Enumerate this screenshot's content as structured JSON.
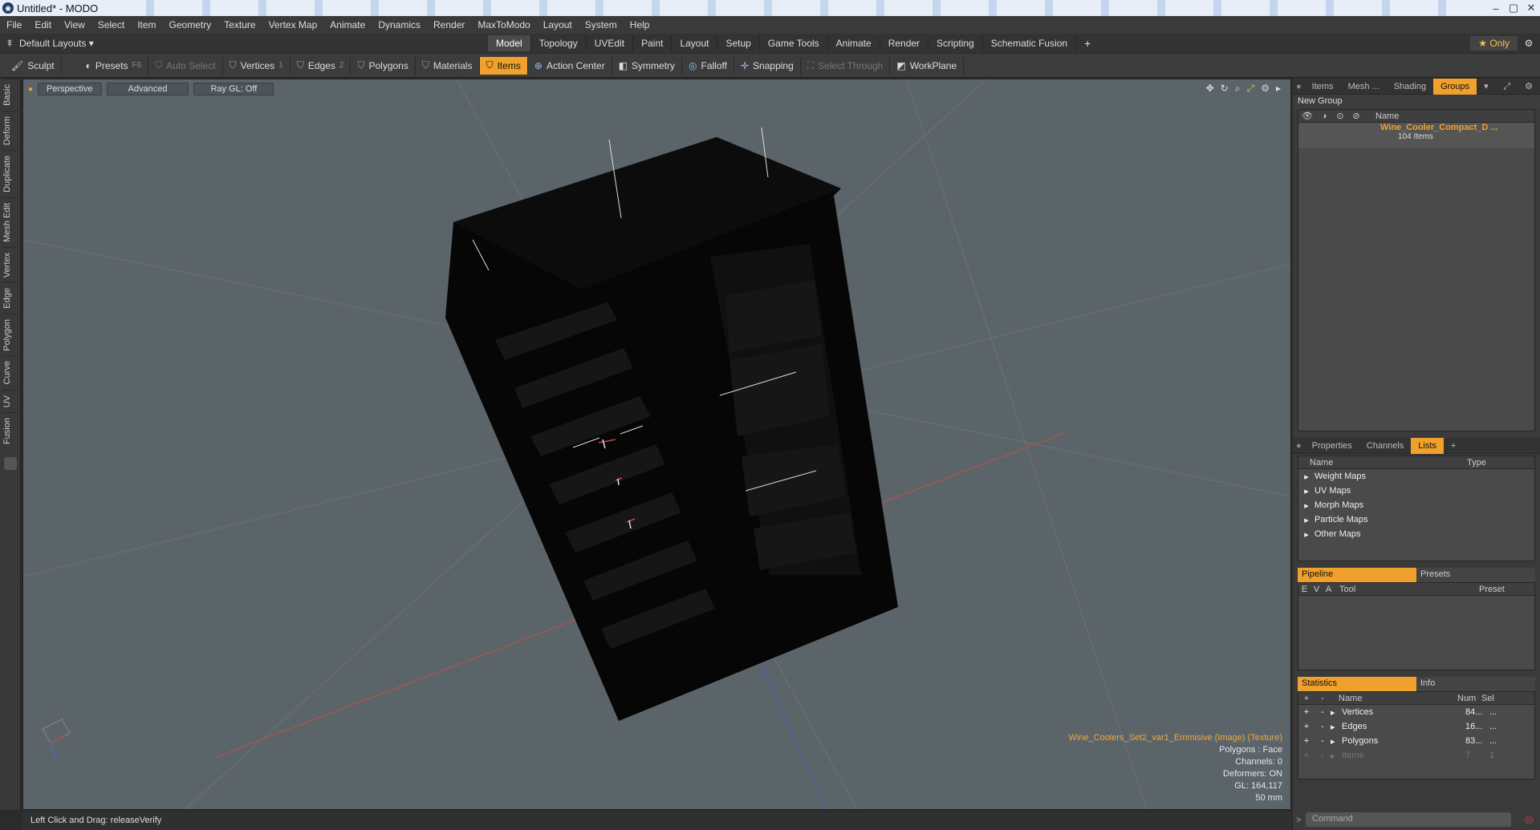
{
  "window": {
    "title": "Untitled* - MODO"
  },
  "menu": [
    "File",
    "Edit",
    "View",
    "Select",
    "Item",
    "Geometry",
    "Texture",
    "Vertex Map",
    "Animate",
    "Dynamics",
    "Render",
    "MaxToModo",
    "Layout",
    "System",
    "Help"
  ],
  "layout": {
    "preset": "Default Layouts ▾",
    "tabs": [
      "Model",
      "Topology",
      "UVEdit",
      "Paint",
      "Layout",
      "Setup",
      "Game Tools",
      "Animate",
      "Render",
      "Scripting",
      "Schematic Fusion"
    ],
    "active_tab": "Model",
    "add": "+",
    "only": "★ Only"
  },
  "toolbar": {
    "sculpt": "Sculpt",
    "presets": "Presets",
    "presets_key": "F6",
    "auto_select": "Auto Select",
    "vertices": "Vertices",
    "vertices_key": "1",
    "edges": "Edges",
    "edges_key": "2",
    "polygons": "Polygons",
    "materials": "Materials",
    "items": "Items",
    "action_center": "Action Center",
    "symmetry": "Symmetry",
    "falloff": "Falloff",
    "snapping": "Snapping",
    "select_through": "Select Through",
    "workplane": "WorkPlane"
  },
  "left_tabs": [
    "Basic",
    "Deform",
    "Duplicate",
    "Mesh Edit",
    "Vertex",
    "Edge",
    "Polygon",
    "Curve",
    "UV",
    "Fusion"
  ],
  "viewport": {
    "view": "Perspective",
    "mode": "Advanced",
    "raygl": "Ray GL: Off",
    "info": {
      "texture": "Wine_Coolers_Set2_var1_Emmisive (Image) (Texture)",
      "polygons": "Polygons : Face",
      "channels": "Channels: 0",
      "deformers": "Deformers: ON",
      "gl": "GL: 164,117",
      "size": "50 mm"
    }
  },
  "status": {
    "text": "Left Click and Drag:   releaseVerify"
  },
  "right_panel": {
    "top_tabs": [
      "Items",
      "Mesh ...",
      "Shading",
      "Groups"
    ],
    "active_top_tab": "Groups",
    "new_group": "New Group",
    "groups_header": "Name",
    "group_name": "Wine_Cooler_Compact_D ...",
    "group_count": "104 Items",
    "mid_tabs": [
      "Properties",
      "Channels",
      "Lists"
    ],
    "active_mid_tab": "Lists",
    "lists_header": {
      "name": "Name",
      "type": "Type"
    },
    "lists": [
      "Weight Maps",
      "UV Maps",
      "Morph Maps",
      "Particle Maps",
      "Other Maps"
    ],
    "pipeline_tabs": [
      "Pipeline",
      "Presets"
    ],
    "pipeline_header": {
      "e": "E",
      "v": "V",
      "a": "A",
      "tool": "Tool",
      "preset": "Preset"
    },
    "stats_tabs": [
      "Statistics",
      "Info"
    ],
    "stats_header": {
      "name": "Name",
      "num": "Num",
      "sel": "Sel"
    },
    "stats": [
      {
        "name": "Vertices",
        "num": "84...",
        "sel": "..."
      },
      {
        "name": "Edges",
        "num": "16...",
        "sel": "..."
      },
      {
        "name": "Polygons",
        "num": "83...",
        "sel": "..."
      },
      {
        "name": "Items",
        "num": "7",
        "sel": "1"
      }
    ],
    "command_placeholder": "Command"
  }
}
